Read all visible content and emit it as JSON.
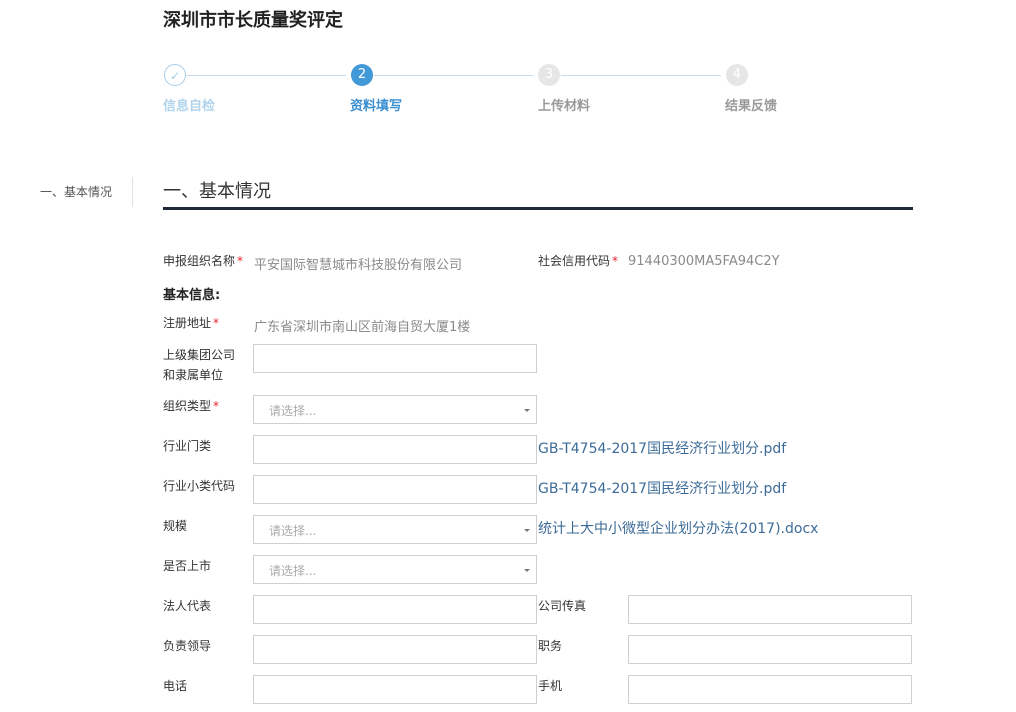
{
  "page": {
    "title": "深圳市市长质量奖评定"
  },
  "steps": [
    {
      "num": "2",
      "label": "资料填写"
    },
    {
      "num": "3",
      "label": "上传材料"
    },
    {
      "num": "4",
      "label": "结果反馈"
    }
  ],
  "step_done": {
    "icon": "check-icon",
    "label": "信息自检"
  },
  "side_nav": {
    "item": "一、基本情况"
  },
  "section": {
    "title": "一、基本情况"
  },
  "form": {
    "org_name": {
      "label": "申报组织名称",
      "value": "平安国际智慧城市科技股份有限公司"
    },
    "credit_code": {
      "label": "社会信用代码",
      "value": "91440300MA5FA94C2Y"
    },
    "basic_info": "基本信息:",
    "reg_address": {
      "label": "注册地址",
      "value": "广东省深圳市南山区前海自贸大厦1楼"
    },
    "parent_group": {
      "label1": "上级集团公司",
      "label2": "和隶属单位",
      "value": ""
    },
    "org_type": {
      "label": "组织类型",
      "placeholder": "请选择..."
    },
    "industry_category": {
      "label": "行业门类",
      "value": "",
      "link": "GB-T4754-2017国民经济行业划分.pdf"
    },
    "industry_sub_code": {
      "label": "行业小类代码",
      "value": "",
      "link": "GB-T4754-2017国民经济行业划分.pdf"
    },
    "scale": {
      "label": "规模",
      "placeholder": "请选择...",
      "link": "统计上大中小微型企业划分办法(2017).docx"
    },
    "listed": {
      "label": "是否上市",
      "placeholder": "请选择..."
    },
    "legal_rep": {
      "label": "法人代表",
      "value": ""
    },
    "company_fax": {
      "label": "公司传真",
      "value": ""
    },
    "leader": {
      "label": "负责领导",
      "value": ""
    },
    "position": {
      "label": "职务",
      "value": ""
    },
    "phone": {
      "label": "电话",
      "value": ""
    },
    "mobile": {
      "label": "手机",
      "value": ""
    }
  },
  "colors": {
    "accent": "#4299d8",
    "required": "#e5262e",
    "link": "#3d6b97",
    "rule": "#1f2a36"
  }
}
